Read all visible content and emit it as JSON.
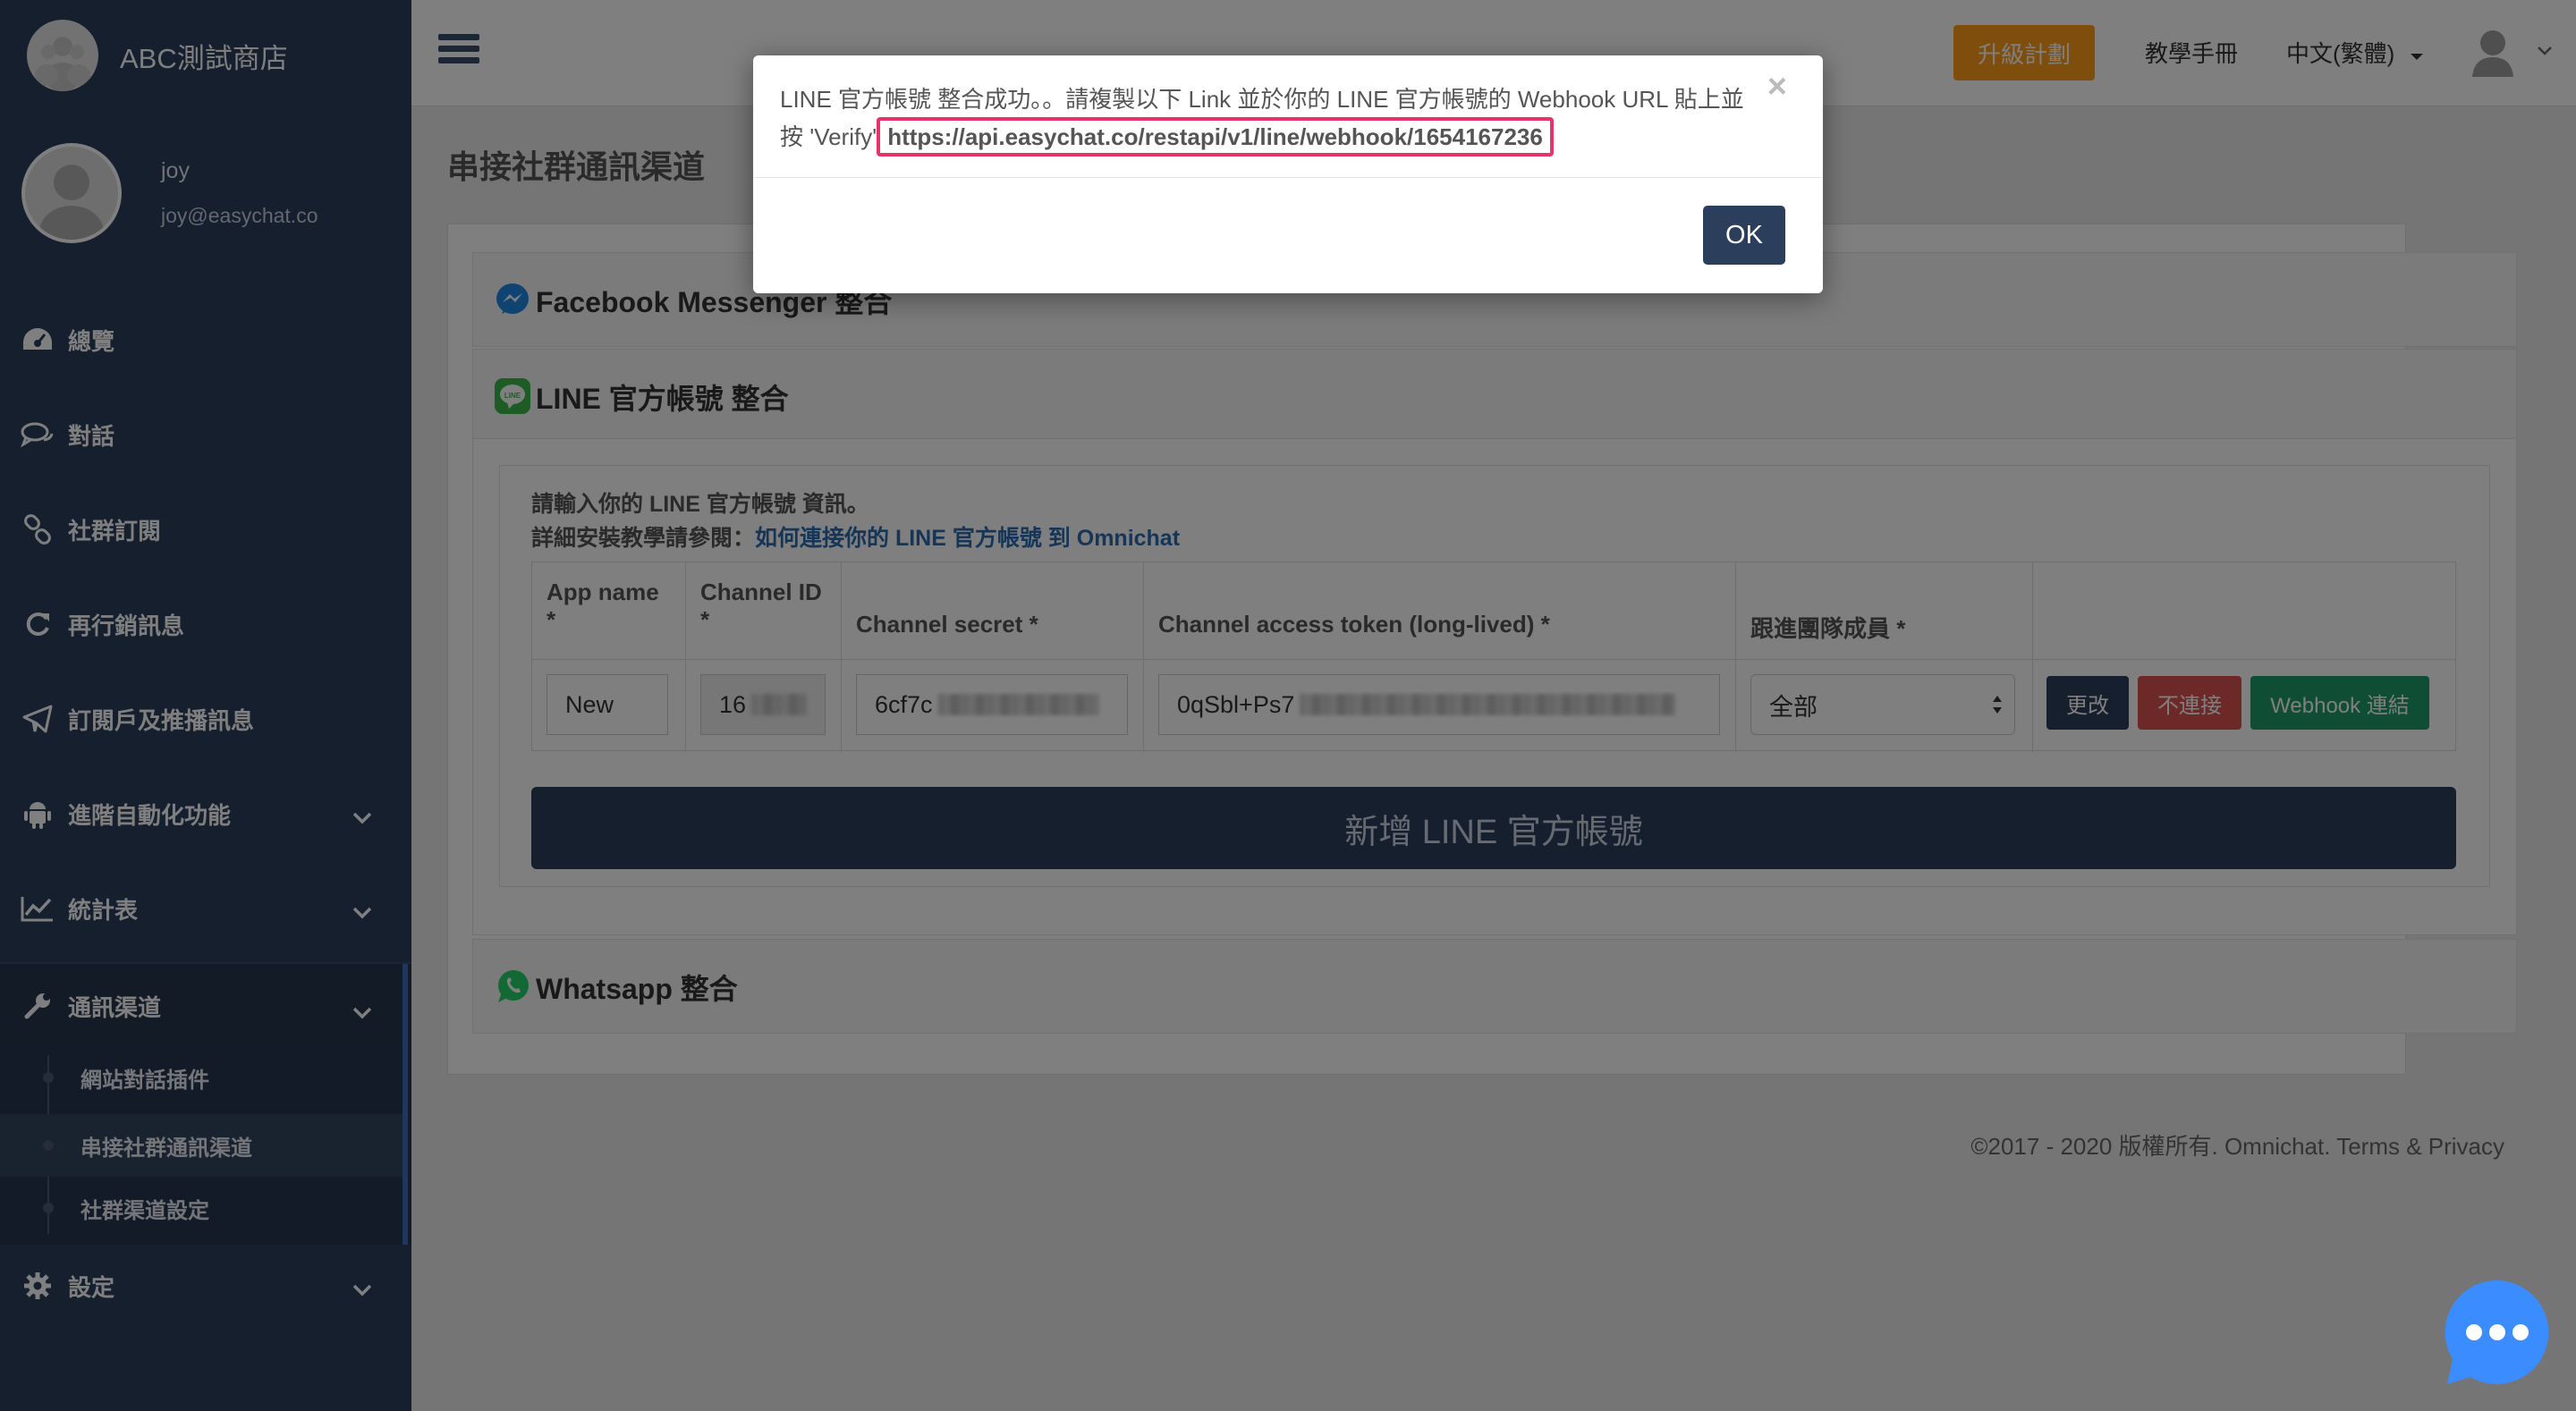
{
  "brand": {
    "name": "ABC測試商店"
  },
  "user": {
    "name": "joy",
    "email": "joy@easychat.co"
  },
  "sidebar": {
    "items": [
      {
        "label": "總覽",
        "icon": "dashboard-icon"
      },
      {
        "label": "對話",
        "icon": "chat-icon"
      },
      {
        "label": "社群訂閱",
        "icon": "link-icon"
      },
      {
        "label": "再行銷訊息",
        "icon": "refresh-icon"
      },
      {
        "label": "訂閱戶及推播訊息",
        "icon": "paper-plane-icon"
      },
      {
        "label": "進階自動化功能",
        "icon": "android-icon"
      },
      {
        "label": "統計表",
        "icon": "line-chart-icon"
      },
      {
        "label": "通訊渠道",
        "icon": "wrench-icon"
      },
      {
        "label": "設定",
        "icon": "gear-icon"
      }
    ],
    "subitems": [
      {
        "label": "網站對話插件"
      },
      {
        "label": "串接社群通訊渠道"
      },
      {
        "label": "社群渠道設定"
      }
    ]
  },
  "topbar": {
    "upgrade": "升級計劃",
    "manual": "教學手冊",
    "language": "中文(繁體)"
  },
  "page": {
    "title": "串接社群通訊渠道"
  },
  "channels": {
    "facebook": {
      "title": "Facebook Messenger 整合"
    },
    "line": {
      "title": "LINE 官方帳號 整合"
    },
    "whatsapp": {
      "title": "Whatsapp 整合"
    }
  },
  "line_form": {
    "info_line1": "請輸入你的 LINE 官方帳號 資訊。",
    "info_line2_prefix": "詳細安裝教學請參閱：",
    "info_line2_link": "如何連接你的 LINE 官方帳號 到 Omnichat",
    "columns": [
      "App name *",
      "Channel ID *",
      "Channel secret *",
      "Channel access token (long-lived) *",
      "跟進團隊成員 *"
    ],
    "row": {
      "app_name": "New",
      "channel_id": "16",
      "channel_secret": "6cf7c",
      "access_token": "0qSbl+Ps7",
      "team_member": "全部"
    },
    "buttons": {
      "edit": "更改",
      "disconnect": "不連接",
      "webhook": "Webhook 連結"
    },
    "add_button": "新增 LINE 官方帳號"
  },
  "footer": {
    "text": "©2017 - 2020 版權所有. Omnichat. Terms & Privacy"
  },
  "modal": {
    "message": "LINE 官方帳號 整合成功。。請複製以下 Link 並於你的 LINE 官方帳號的 Webhook URL 貼上並按 'Verify'",
    "url": "https://api.easychat.co/restapi/v1/line/webhook/1654167236",
    "ok": "OK",
    "close": "×"
  },
  "colors": {
    "sidebar": "#2b3e5c",
    "upgrade": "#ff9d1a",
    "edit": "#2b3e5c",
    "disconnect": "#d9534f",
    "webhook": "#1f9d6b",
    "highlight": "#e8336a",
    "chat": "#3b8cff"
  }
}
